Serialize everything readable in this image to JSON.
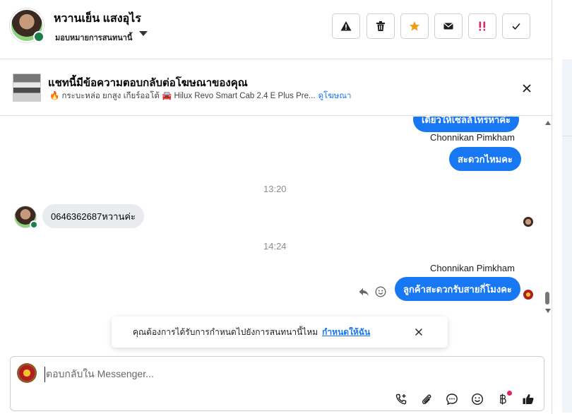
{
  "header": {
    "contact_name": "หวานเย็น แสงอุไร",
    "assign_label": "มอบหมายการสนทนานี้",
    "buttons": [
      {
        "name": "spam",
        "icon": "warning-icon"
      },
      {
        "name": "delete",
        "icon": "trash-icon"
      },
      {
        "name": "star",
        "icon": "star-icon",
        "color": "#f39c12"
      },
      {
        "name": "mail",
        "icon": "envelope-icon"
      },
      {
        "name": "followup",
        "icon": "exclamation-icon",
        "color": "#e0245e"
      },
      {
        "name": "done",
        "icon": "check-icon"
      }
    ]
  },
  "ad_bar": {
    "title": "แชทนี้มีข้อความตอบกลับต่อโฆษณาของคุณ",
    "description": "🔥 กระบะหล่อ ยกสูง เกียร์ออโต้ 🚘 Hilux Revo Smart Cab 2.4 E Plus Pre...",
    "link": "ดูโฆษณา"
  },
  "messages": {
    "partial_out": "เดี๋ยวให้เซลล์โทรหาค่ะ",
    "sender_1": "Chonnikan Pimkham",
    "out_1": "สะดวกไหมคะ",
    "time_1": "13:20",
    "in_1": "0646362687หวานค่ะ",
    "time_2": "14:24",
    "sender_2": "Chonnikan Pimkham",
    "out_2": "ลูกค้าสะดวกรับสายกี่โมงคะ"
  },
  "notice": {
    "text": "คุณต้องการได้รับการกำหนดไปยังการสนทนานี้ไหม",
    "link": "กำหนดให้ฉัน"
  },
  "composer": {
    "placeholder": "ตอบกลับใน Messenger...",
    "tools": [
      "phone-plus-icon",
      "paperclip-icon",
      "chat-bubble-icon",
      "emoji-icon",
      "baht-icon",
      "thumbs-up-icon"
    ]
  },
  "colors": {
    "accent": "#1877f2",
    "bubble_in": "#e9ebee"
  }
}
